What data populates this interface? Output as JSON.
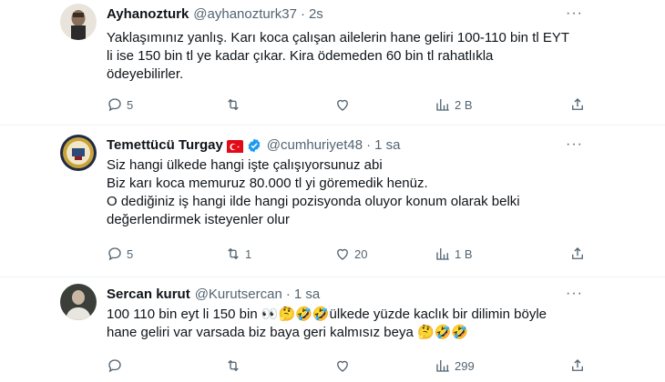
{
  "tweets": [
    {
      "name": "Ayhanozturk",
      "handle": "@ayhanozturk37",
      "time": "2s",
      "lines": [
        "Yaklaşımınız yanlış. Karı koca çalışan ailelerin hane geliri 100-110 bin tl  EYT",
        "li ise 150 bin tl ye kadar çıkar. Kira ödemeden 60 bin tl rahatlıkla",
        "ödeyebilirler."
      ],
      "stats": {
        "replies": "5",
        "retweets": "",
        "likes": "",
        "views": "2 B"
      }
    },
    {
      "name": "Temettücü Turgay",
      "handle": "@cumhuriyet48",
      "time": "1 sa",
      "lines": [
        "Siz hangi ülkede hangi işte çalışıyorsunuz abi",
        "Biz karı koca memuruz 80.000 tl yi göremedik henüz.",
        "O dediğiniz iş hangi ilde hangi pozisyonda oluyor konum olarak belki",
        "değerlendirmek isteyenler olur"
      ],
      "stats": {
        "replies": "5",
        "retweets": "1",
        "likes": "20",
        "views": "1 B"
      }
    },
    {
      "name": "Sercan kurut",
      "handle": "@Kurutsercan",
      "time": "1 sa",
      "lines": [
        "100 110 bin eyt li 150 bin 👀🤔🤣🤣ülkede yüzde kaclık bir dilimin böyle",
        "hane geliri var varsada biz baya geri kalmısız beya 🤔🤣🤣"
      ],
      "stats": {
        "replies": "",
        "retweets": "",
        "likes": "",
        "views": "299"
      }
    }
  ],
  "colors": {
    "text": "#0f1419",
    "muted": "#536471",
    "verified": "#1d9bf0",
    "flag": "#e30a17"
  },
  "icons": [
    "reply-icon",
    "retweet-icon",
    "like-icon",
    "views-icon",
    "share-icon",
    "more-icon",
    "verified-badge-icon",
    "turkey-flag-icon"
  ]
}
